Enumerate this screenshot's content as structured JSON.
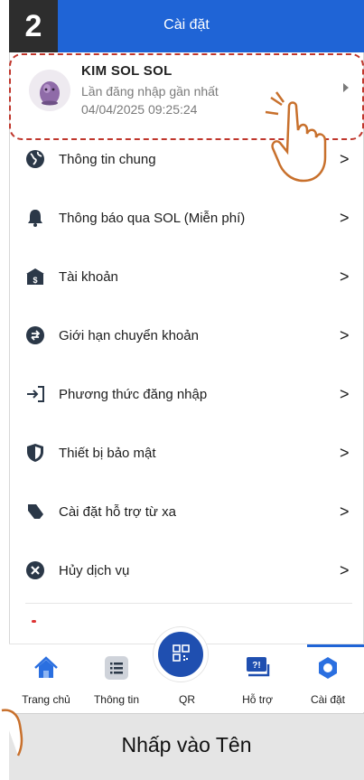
{
  "header": {
    "title": "Cài đặt",
    "step_number": "2"
  },
  "profile": {
    "name": "KIM SOL SOL",
    "subtitle": "Lần đăng nhập gần nhất",
    "timestamp": "04/04/2025 09:25:24"
  },
  "menu": {
    "items": [
      {
        "label": "Thông tin chung",
        "icon": "globe-icon"
      },
      {
        "label": "Thông báo qua SOL (Miễn phí)",
        "icon": "bell-icon"
      },
      {
        "label": "Tài khoản",
        "icon": "bank-account-icon"
      },
      {
        "label": "Giới hạn chuyển khoản",
        "icon": "transfer-limit-icon"
      },
      {
        "label": "Phương thức đăng nhập",
        "icon": "login-icon"
      },
      {
        "label": "Thiết bị bảo mật",
        "icon": "shield-icon"
      },
      {
        "label": "Cài đặt hỗ trợ từ xa",
        "icon": "remote-support-icon"
      },
      {
        "label": "Hủy dịch vụ",
        "icon": "cancel-icon"
      }
    ],
    "chevron": ">"
  },
  "bottom_nav": {
    "items": [
      {
        "label": "Trang chủ",
        "icon": "home-icon"
      },
      {
        "label": "Thông tin",
        "icon": "list-icon"
      },
      {
        "label": "QR",
        "icon": "qr-icon"
      },
      {
        "label": "Hỗ trợ",
        "icon": "support-icon"
      },
      {
        "label": "Cài đặt",
        "icon": "settings-icon"
      }
    ],
    "active": "Cài đặt"
  },
  "caption": {
    "text": "Nhấp vào Tên"
  },
  "colors": {
    "primary": "#1f64d6",
    "highlight": "#c0362c",
    "icon": "#2b3848",
    "hand": "#c8702c"
  }
}
